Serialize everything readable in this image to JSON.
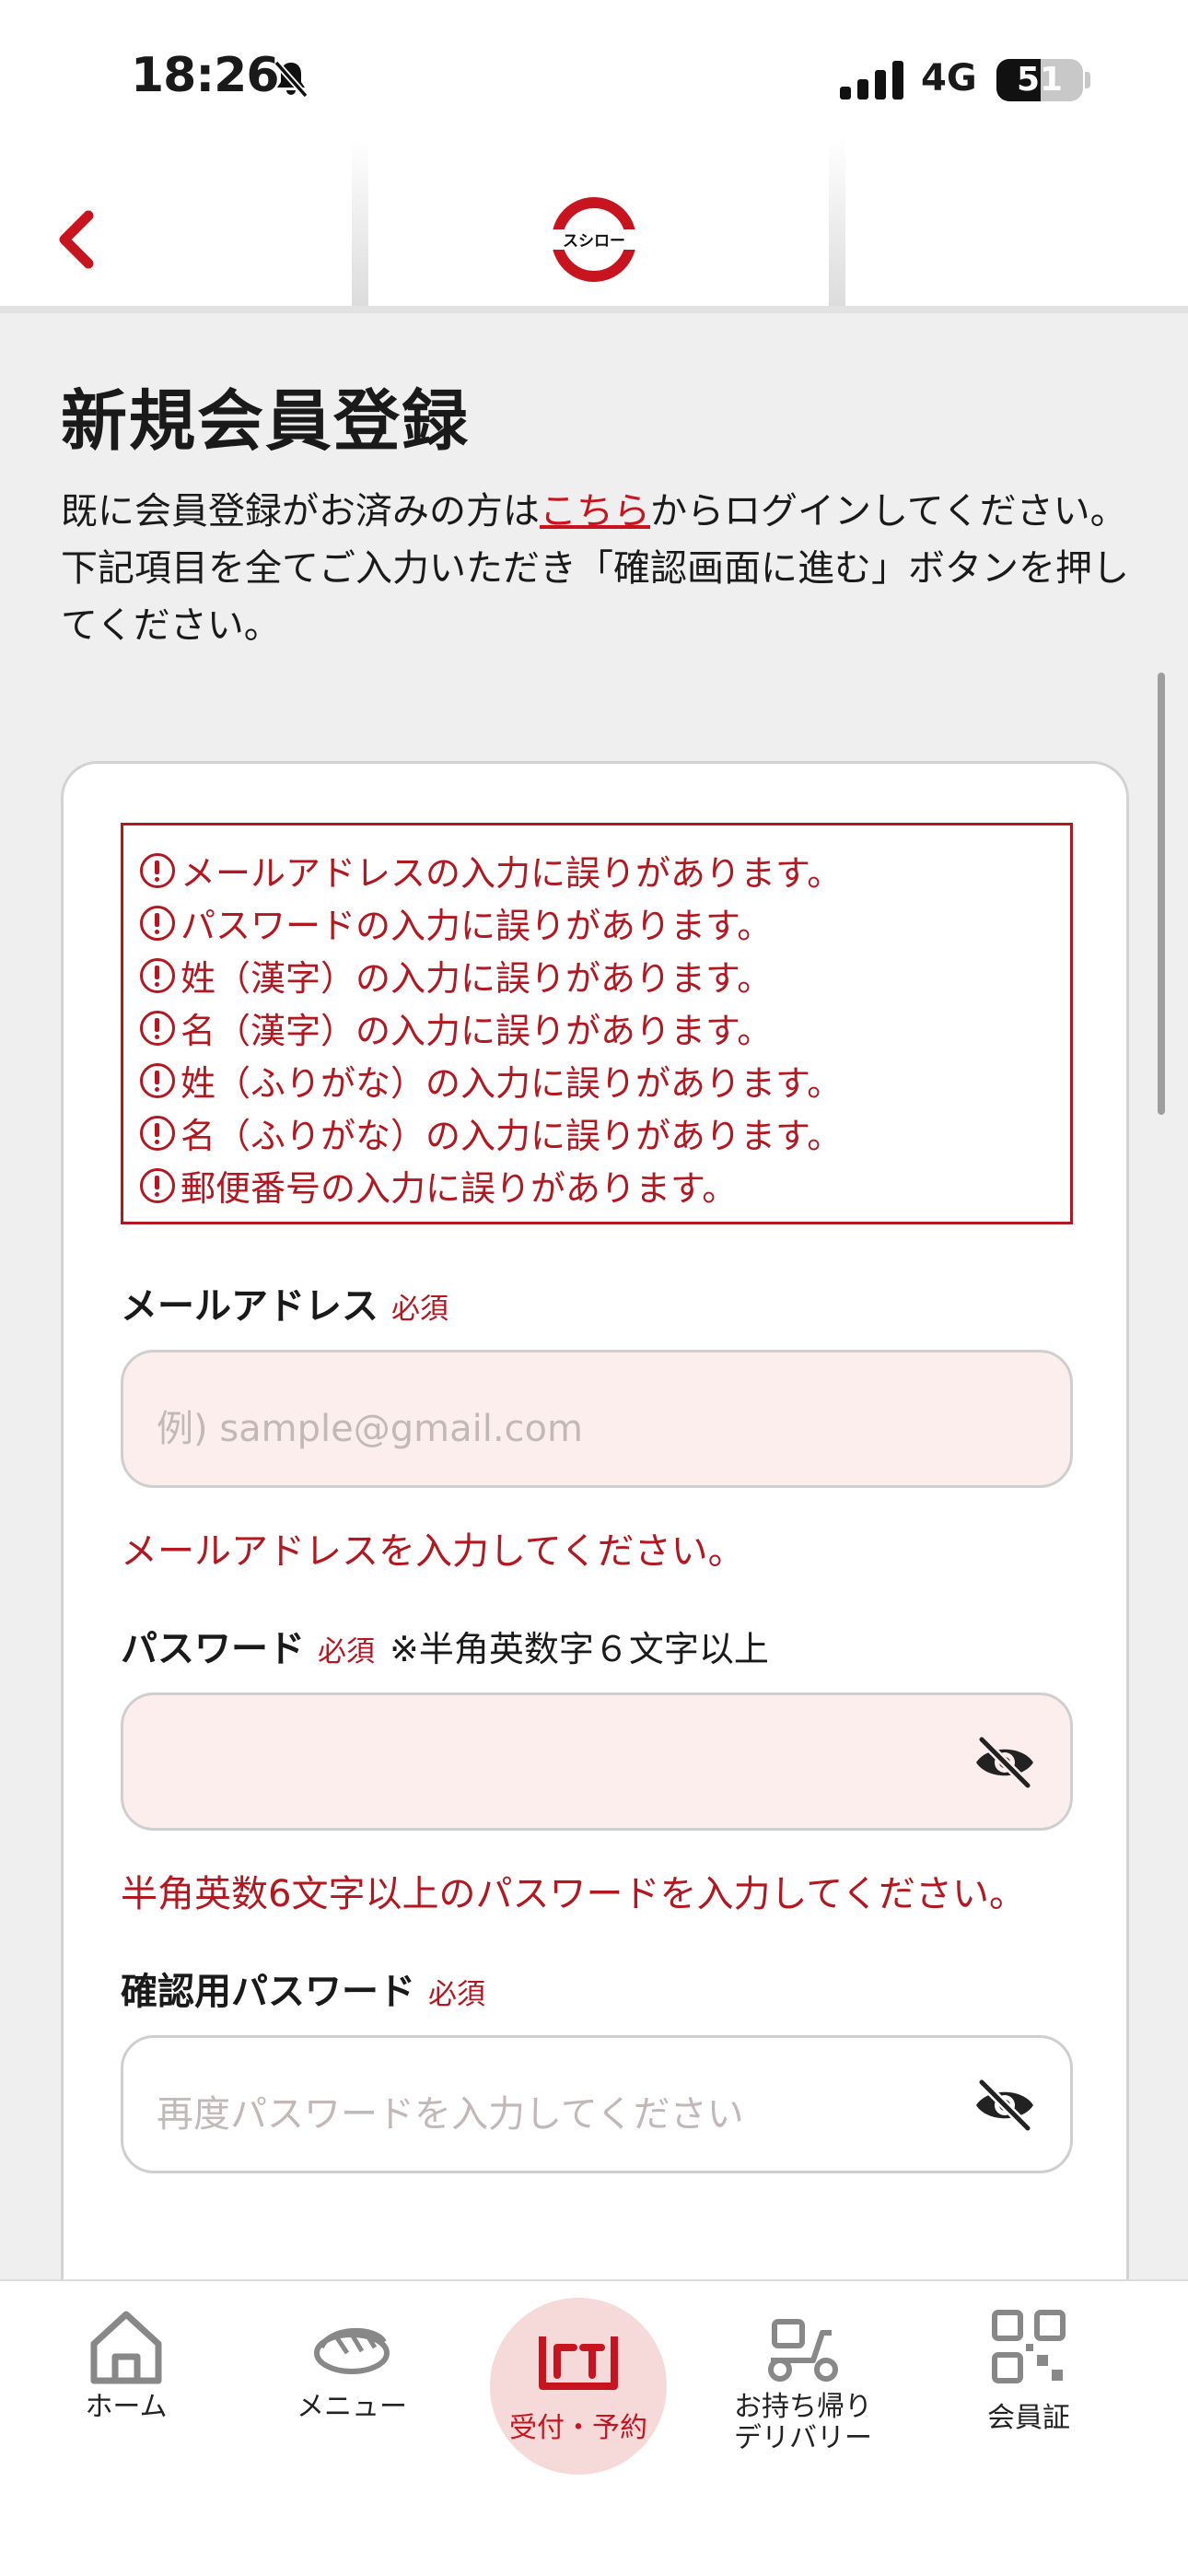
{
  "status_bar": {
    "time": "18:26",
    "network": "4G",
    "battery_level": "51",
    "battery_fraction": 0.51
  },
  "header": {
    "logo_text": "スシロー",
    "brand_color": "#c8141e"
  },
  "page": {
    "title": "新規会員登録",
    "intro_prefix": "既に会員登録がお済みの方は",
    "intro_link": "こちら",
    "intro_suffix": "からログインしてください。",
    "intro_line2": "下記項目を全てご入力いただき「確認画面に進む」ボタンを押してください。"
  },
  "errors": [
    "メールアドレスの入力に誤りがあります。",
    "パスワードの入力に誤りがあります。",
    "姓（漢字）の入力に誤りがあります。",
    "名（漢字）の入力に誤りがあります。",
    "姓（ふりがな）の入力に誤りがあります。",
    "名（ふりがな）の入力に誤りがあります。",
    "郵便番号の入力に誤りがあります。"
  ],
  "form": {
    "email": {
      "label": "メールアドレス",
      "required": "必須",
      "placeholder": "例) sample@gmail.com",
      "value": "",
      "error": "メールアドレスを入力してください。"
    },
    "password": {
      "label": "パスワード",
      "required": "必須",
      "note": "※半角英数字６文字以上",
      "value": "",
      "error": "半角英数6文字以上のパスワードを入力してください。"
    },
    "confirm_password": {
      "label": "確認用パスワード",
      "required": "必須",
      "placeholder": "再度パスワードを入力してください",
      "value": ""
    }
  },
  "tabbar": {
    "items": [
      {
        "label": "ホーム",
        "icon": "home-icon"
      },
      {
        "label": "メニュー",
        "icon": "sushi-icon"
      },
      {
        "label": "受付・予約",
        "icon": "reception-icon",
        "active": true
      },
      {
        "label": "お持ち帰り\nデリバリー",
        "icon": "delivery-scooter-icon"
      },
      {
        "label": "会員証",
        "icon": "qr-code-icon"
      }
    ]
  }
}
